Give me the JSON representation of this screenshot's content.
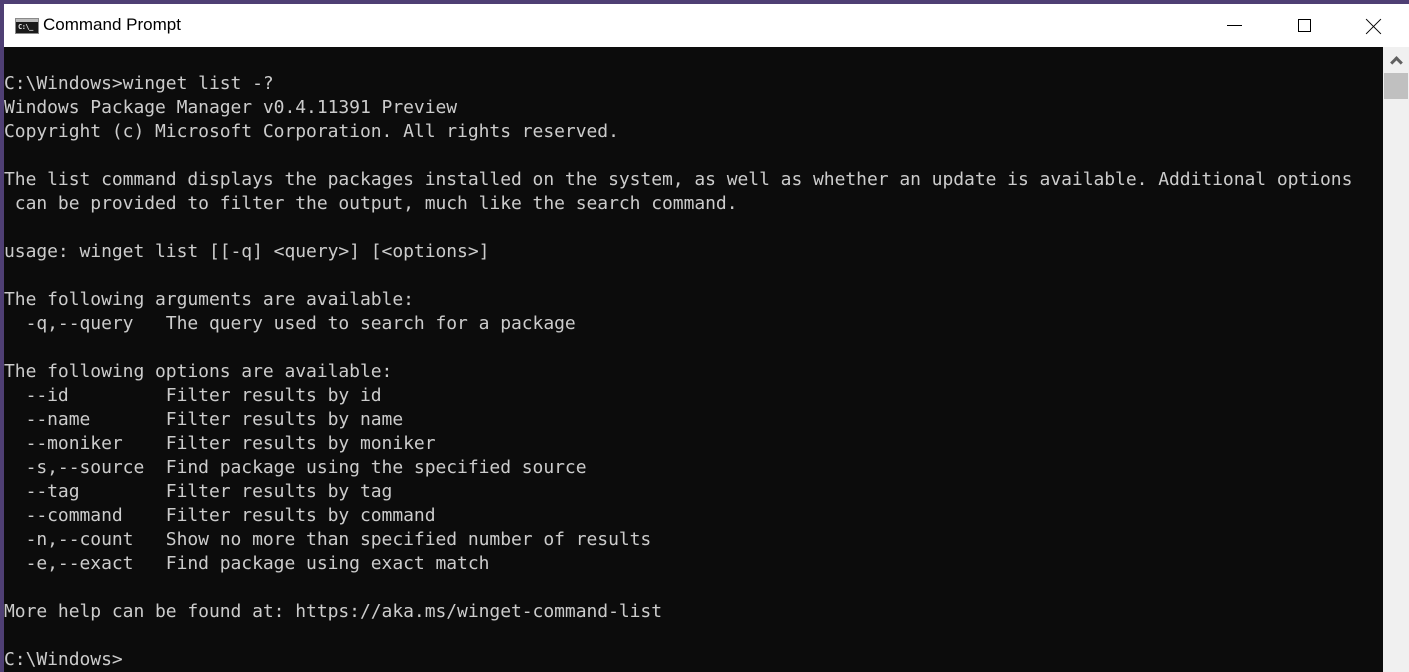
{
  "window": {
    "title": "Command Prompt",
    "app_icon_glyph": "C:\\_",
    "controls": {
      "minimize": "minimize-icon",
      "maximize": "maximize-icon",
      "close": "close-icon"
    }
  },
  "console": {
    "lines": [
      "C:\\Windows>winget list -?",
      "Windows Package Manager v0.4.11391 Preview",
      "Copyright (c) Microsoft Corporation. All rights reserved.",
      "",
      "The list command displays the packages installed on the system, as well as whether an update is available. Additional options",
      " can be provided to filter the output, much like the search command.",
      "",
      "usage: winget list [[-q] <query>] [<options>]",
      "",
      "The following arguments are available:",
      "  -q,--query   The query used to search for a package",
      "",
      "The following options are available:",
      "  --id         Filter results by id",
      "  --name       Filter results by name",
      "  --moniker    Filter results by moniker",
      "  -s,--source  Find package using the specified source",
      "  --tag        Filter results by tag",
      "  --command    Filter results by command",
      "  -n,--count   Show no more than specified number of results",
      "  -e,--exact   Find package using exact match",
      "",
      "More help can be found at: https://aka.ms/winget-command-list",
      "",
      "C:\\Windows>"
    ],
    "text_color": "#cccccc",
    "background_color": "#0c0c0c"
  },
  "scrollbar": {
    "up_arrow": "chevron-up-icon",
    "position": 0
  }
}
